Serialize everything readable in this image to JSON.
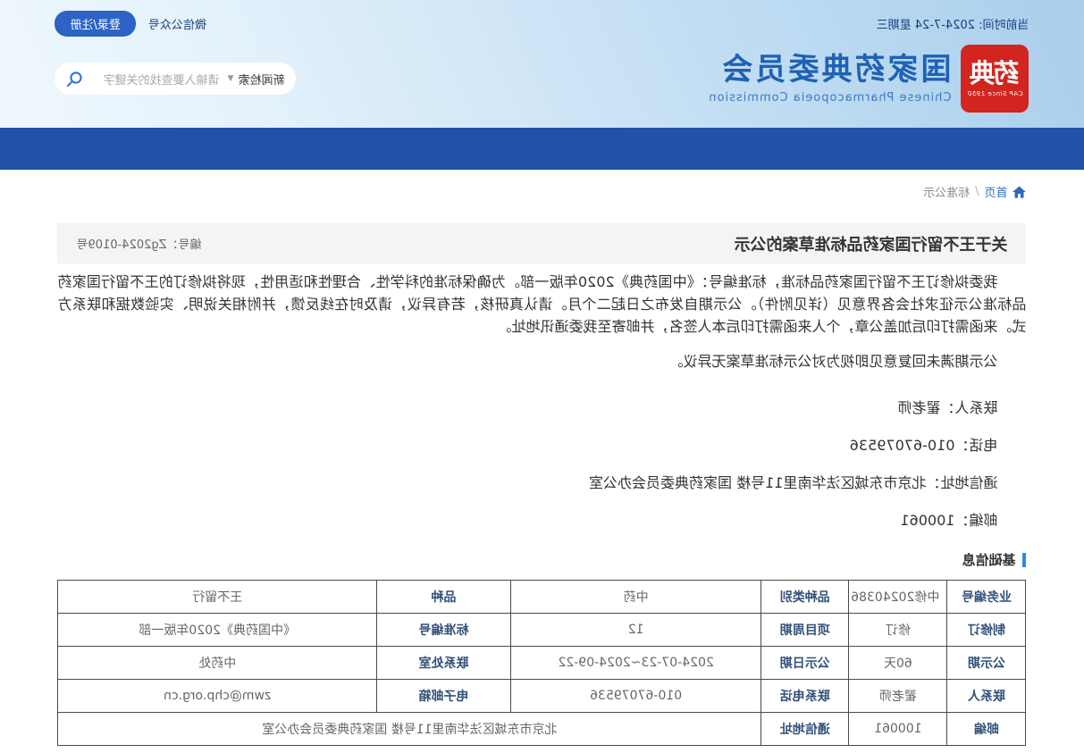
{
  "header": {
    "current_time": "当前时间: 2024-7-24 星期三",
    "wechat_label": "微信公众号",
    "login_label": "登录/注册",
    "search": {
      "category": "新闻检索",
      "placeholder": "请输入要查找的关键字"
    },
    "logo": {
      "seal_text": "药典",
      "seal_caption": "CAP Since 1950",
      "title_cn": "国家药典委员会",
      "title_en": "Chinese Pharmacopoeia Commission"
    }
  },
  "breadcrumb": {
    "home": "首页",
    "separator": "/",
    "current": "标准公示"
  },
  "notice": {
    "title": "关于王不留行国家药品标准草案的公示",
    "number": "编号：Zg2024-0109号",
    "paragraphs": [
      "我委拟修订王不留行国家药品标准，标准编号：《中国药典》2020年版一部。为确保标准的科学性、合理性和适用性，现将拟修订的王不留行国家药品标准公示征求社会各界意见（详见附件）。公示期自发布之日起二个月。请认真研核，若有异议，请及时在线反馈，并附相关说明、实验数据和联系方式。来函需打印后加盖公章，个人来函需打印后本人签名，并邮寄至我委通讯地址。",
      "公示期满未回复意见即视为对公示标准草案无异议。"
    ],
    "contacts": [
      "联系人：翟老师",
      "电话：010-67079536",
      "通信地址：北京市东城区法华南里11号楼  国家药典委员会办公室",
      "邮编：100061"
    ]
  },
  "basic_info": {
    "section_title": "基础信息",
    "rows": [
      [
        {
          "label": "业务编号",
          "value": "中修20240386"
        },
        {
          "label": "品种类别",
          "value": "中药"
        },
        {
          "label": "品种",
          "value": "王不留行"
        }
      ],
      [
        {
          "label": "制修订",
          "value": "修订"
        },
        {
          "label": "项目周期",
          "value": "12"
        },
        {
          "label": "标准编号",
          "value": "《中国药典》2020年版一部"
        }
      ],
      [
        {
          "label": "公示期",
          "value": "60天"
        },
        {
          "label": "公示日期",
          "value": "2024-07-23~2024-09-22"
        },
        {
          "label": "联系处室",
          "value": "中药处"
        }
      ],
      [
        {
          "label": "联系人",
          "value": "翟老师"
        },
        {
          "label": "联系电话",
          "value": "010-67079536"
        },
        {
          "label": "电子邮箱",
          "value": "zwm@chp.org.cn"
        }
      ],
      [
        {
          "label": "邮编",
          "value": "100061"
        },
        {
          "label": "通信地址",
          "value": "北京市东城区法华南里11号楼  国家药典委员会办公室",
          "colspan": 3
        }
      ]
    ]
  },
  "colors": {
    "nav_band": "#2152a7",
    "login_button": "#2c63c5",
    "logo_blue": "#2061b3",
    "seal_red": "#d2251f",
    "accent_bar": "#2a8ce8",
    "label_text": "#33517a"
  }
}
